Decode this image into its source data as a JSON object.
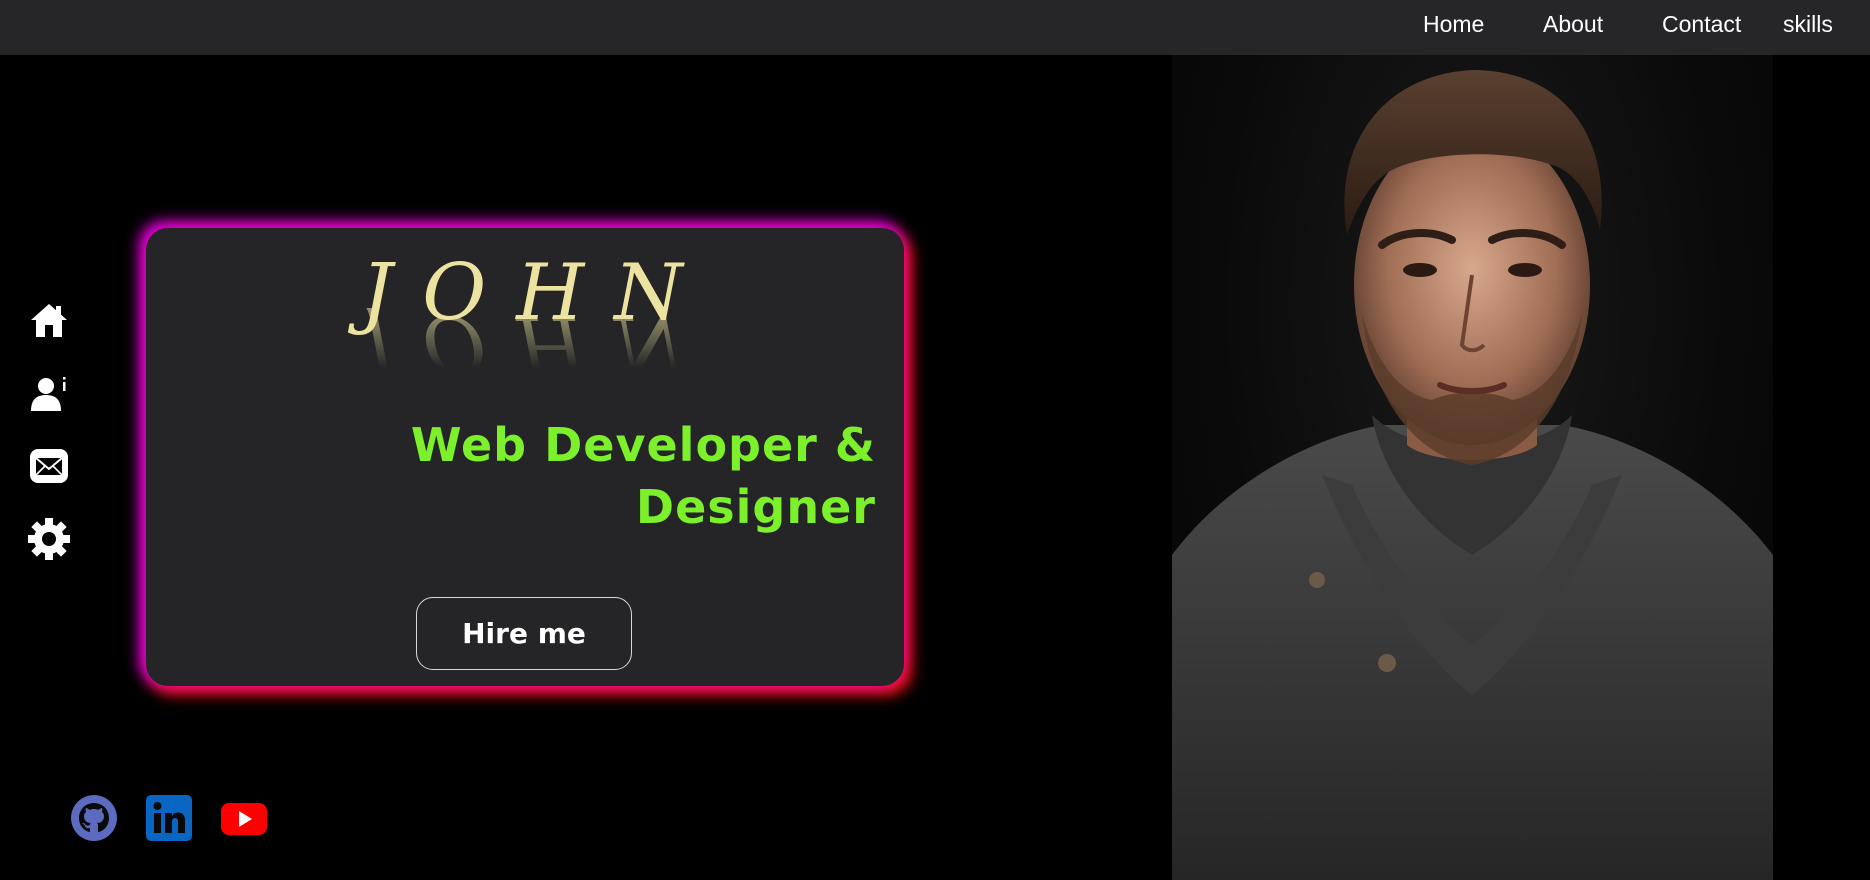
{
  "nav": {
    "items": [
      {
        "label": "Home"
      },
      {
        "label": "About"
      },
      {
        "label": "Contact"
      },
      {
        "label": "skills"
      }
    ]
  },
  "sidebar": {
    "icons": [
      "home-icon",
      "user-info-icon",
      "mail-icon",
      "gear-icon"
    ]
  },
  "hero": {
    "name": "JOHN",
    "role": "Web Developer & Designer",
    "cta_label": "Hire me"
  },
  "social": {
    "icons": [
      "github-icon",
      "linkedin-icon",
      "youtube-icon"
    ],
    "colors": {
      "github": "#5c6bc0",
      "linkedin": "#0a66c2",
      "youtube": "#ff0000"
    }
  },
  "colors": {
    "name": "#ece3a0",
    "role": "#7cf02a",
    "glow_top_left": "#f000eb",
    "glow_bottom_right": "#ff1414"
  }
}
